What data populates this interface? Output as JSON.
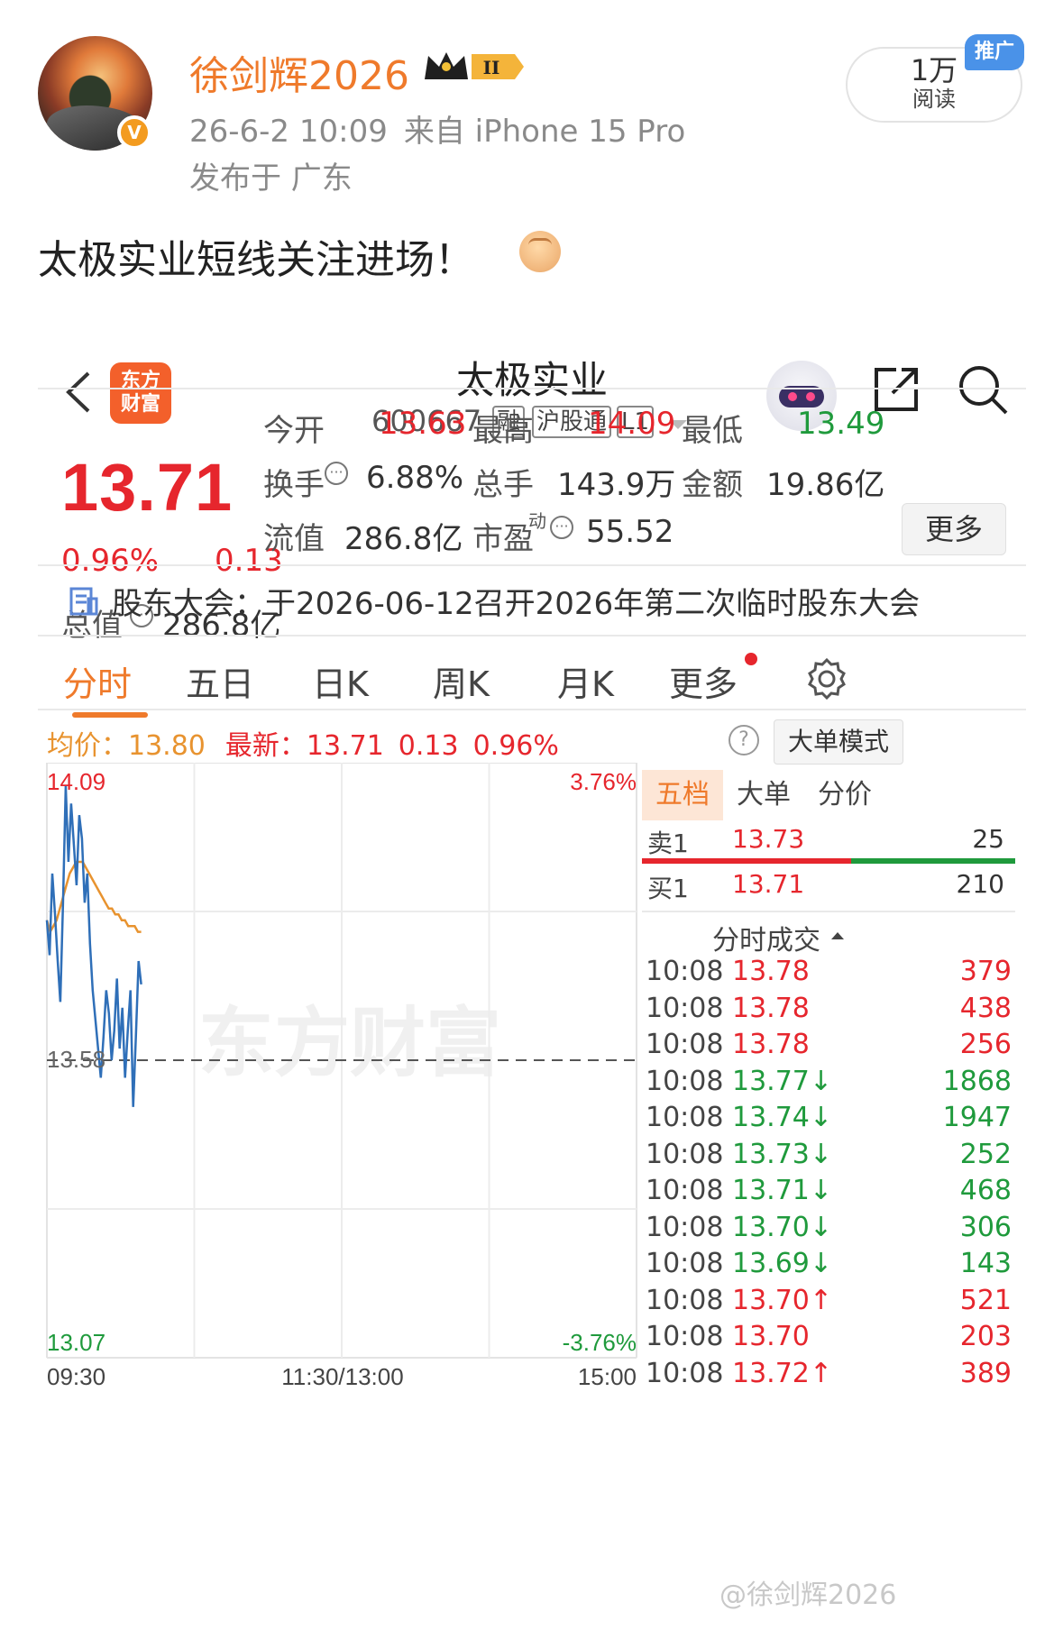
{
  "post": {
    "username": "徐剑辉2026",
    "rank_badge": "II",
    "date": "26-6-2 10:09",
    "source": "来自 iPhone 15 Pro",
    "location": "发布于 广东",
    "reads_count": "1万",
    "reads_label": "阅读",
    "promo": "推广",
    "text": "太极实业短线关注进场！"
  },
  "app": {
    "logo_text_1": "东方",
    "logo_text_2": "财富",
    "stock_name": "太极实业",
    "stock_code": "600667",
    "tags": [
      "融",
      "沪股通",
      "L1"
    ],
    "price": "13.71",
    "change_pct": "0.96%",
    "change_val": "0.13",
    "total_value_label": "总值",
    "total_value": "286.8亿",
    "quotes": [
      {
        "label": "今开",
        "value": "13.63",
        "color": "#e6262d"
      },
      {
        "label": "最高",
        "value": "14.09",
        "color": "#e6262d"
      },
      {
        "label": "最低",
        "value": "13.49",
        "color": "#1f9a3c"
      },
      {
        "label": "换手",
        "value": "6.88%",
        "color": "#333333"
      },
      {
        "label": "总手",
        "value": "143.9万",
        "color": "#333333"
      },
      {
        "label": "金额",
        "value": "19.86亿",
        "color": "#333333"
      },
      {
        "label": "流值",
        "value": "286.8亿",
        "color": "#333333"
      },
      {
        "label": "市盈",
        "value": "55.52",
        "color": "#333333"
      }
    ],
    "pe_sup": "动",
    "more_label": "更多",
    "notice": "股东大会：于2026-06-12召开2026年第二次临时股东大会",
    "tabs": [
      "分时",
      "五日",
      "日K",
      "周K",
      "月K",
      "更多"
    ],
    "avg_label": "均价：",
    "avg_value": "13.80",
    "last_label": "最新：",
    "last_value": "13.71",
    "last_change": "0.13",
    "last_pct": "0.96%",
    "help_icon": "?",
    "mode_label": "大单模式",
    "accent": "#ef7a2b",
    "up_color": "#e6262d",
    "down_color": "#1f9a3c"
  },
  "chart_data": {
    "type": "line",
    "title": "",
    "x_ticks": [
      "09:30",
      "11:30/13:00",
      "15:00"
    ],
    "y_max_label": "14.09",
    "y_mid_label": "13.58",
    "y_min_label": "13.07",
    "pct_max_label": "3.76%",
    "pct_min_label": "-3.76%",
    "ylim": [
      13.07,
      14.09
    ],
    "reference_price": 13.58,
    "series": [
      {
        "color": "#2f6fb8",
        "values": [
          13.82,
          13.76,
          13.9,
          13.83,
          13.75,
          13.68,
          13.85,
          14.05,
          13.92,
          14.02,
          13.95,
          13.88,
          14.0,
          13.96,
          13.85,
          13.9,
          13.78,
          13.7,
          13.65,
          13.6,
          13.55,
          13.62,
          13.7,
          13.66,
          13.58,
          13.63,
          13.72,
          13.6,
          13.67,
          13.55,
          13.63,
          13.7,
          13.5,
          13.62,
          13.75,
          13.71
        ]
      },
      {
        "color": "#e8932f",
        "values": [
          13.82,
          13.8,
          13.81,
          13.82,
          13.84,
          13.86,
          13.88,
          13.9,
          13.91,
          13.92,
          13.92,
          13.92,
          13.91,
          13.9,
          13.89,
          13.88,
          13.87,
          13.86,
          13.85,
          13.84,
          13.84,
          13.83,
          13.83,
          13.82,
          13.82,
          13.81,
          13.81,
          13.81,
          13.8,
          13.8
        ]
      }
    ],
    "grid": true,
    "watermark": "东方财富"
  },
  "right_panel": {
    "tabs": [
      "五档",
      "大单",
      "分价"
    ],
    "ask_label": "卖1",
    "ask_price": "13.73",
    "ask_vol": "25",
    "bid_label": "买1",
    "bid_price": "13.71",
    "bid_vol": "210",
    "trades_header": "分时成交",
    "trades": [
      {
        "time": "10:08",
        "price": "13.78",
        "vol": "379",
        "dir": "",
        "color": "#e6262d"
      },
      {
        "time": "10:08",
        "price": "13.78",
        "vol": "438",
        "dir": "",
        "color": "#e6262d"
      },
      {
        "time": "10:08",
        "price": "13.78",
        "vol": "256",
        "dir": "",
        "color": "#e6262d"
      },
      {
        "time": "10:08",
        "price": "13.77",
        "vol": "1868",
        "dir": "↓",
        "color": "#1f9a3c"
      },
      {
        "time": "10:08",
        "price": "13.74",
        "vol": "1947",
        "dir": "↓",
        "color": "#1f9a3c"
      },
      {
        "time": "10:08",
        "price": "13.73",
        "vol": "252",
        "dir": "↓",
        "color": "#1f9a3c"
      },
      {
        "time": "10:08",
        "price": "13.71",
        "vol": "468",
        "dir": "↓",
        "color": "#1f9a3c"
      },
      {
        "time": "10:08",
        "price": "13.70",
        "vol": "306",
        "dir": "↓",
        "color": "#1f9a3c"
      },
      {
        "time": "10:08",
        "price": "13.69",
        "vol": "143",
        "dir": "↓",
        "color": "#1f9a3c"
      },
      {
        "time": "10:08",
        "price": "13.70",
        "vol": "521",
        "dir": "↑",
        "color": "#e6262d"
      },
      {
        "time": "10:08",
        "price": "13.70",
        "vol": "203",
        "dir": "",
        "color": "#e6262d"
      },
      {
        "time": "10:08",
        "price": "13.72",
        "vol": "389",
        "dir": "↑",
        "color": "#e6262d"
      }
    ]
  },
  "watermark": "@徐剑辉2026"
}
